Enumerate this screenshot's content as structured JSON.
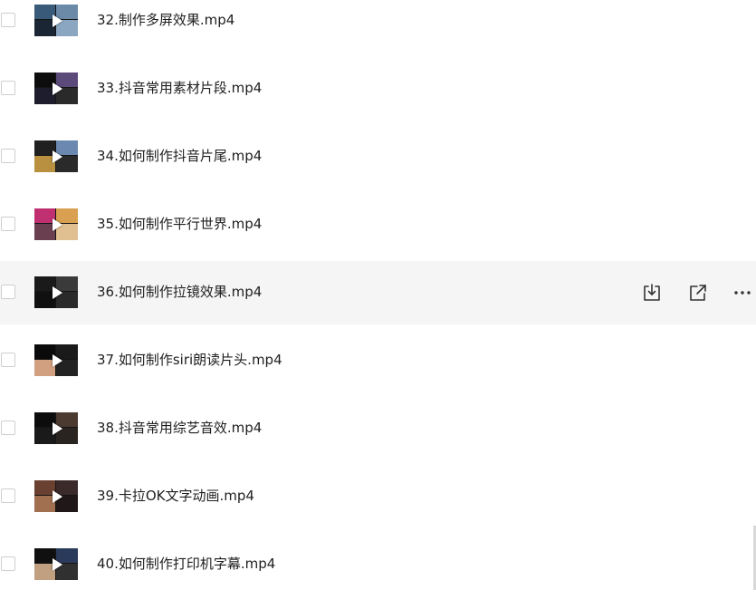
{
  "files": [
    {
      "name": "32.制作多屏效果.mp4",
      "thumb_colors": [
        "#3a5a7a",
        "#6a8aa8",
        "#1a2633",
        "#8aa6c0"
      ]
    },
    {
      "name": "33.抖音常用素材片段.mp4",
      "thumb_colors": [
        "#0d0d0d",
        "#5b4a7a",
        "#1d1d2d",
        "#2a2a2a"
      ]
    },
    {
      "name": "34.如何制作抖音片尾.mp4",
      "thumb_colors": [
        "#202020",
        "#6b88b0",
        "#b89040",
        "#2a2a2a"
      ]
    },
    {
      "name": "35.如何制作平行世界.mp4",
      "thumb_colors": [
        "#c03070",
        "#d8a050",
        "#6a4050",
        "#e0c090"
      ]
    },
    {
      "name": "36.如何制作拉镜效果.mp4",
      "thumb_colors": [
        "#1a1a1a",
        "#3a3a3a",
        "#101010",
        "#2a2a2a"
      ]
    },
    {
      "name": "37.如何制作siri朗读片头.mp4",
      "thumb_colors": [
        "#0a0a0a",
        "#1a1a1a",
        "#d0a080",
        "#222222"
      ]
    },
    {
      "name": "38.抖音常用综艺音效.mp4",
      "thumb_colors": [
        "#0c0c0c",
        "#4a3a30",
        "#1a1a1a",
        "#2a2420"
      ]
    },
    {
      "name": "39.卡拉OK文字动画.mp4",
      "thumb_colors": [
        "#6a4030",
        "#3a2a2a",
        "#a07050",
        "#201818"
      ]
    },
    {
      "name": "40.如何制作打印机字幕.mp4",
      "thumb_colors": [
        "#101010",
        "#2a3a5a",
        "#c0a080",
        "#303030"
      ]
    }
  ],
  "hovered_index": 4,
  "row_actions": {
    "icons": [
      "download-icon",
      "share-icon",
      "more-icon"
    ]
  },
  "colors": {
    "row_hover_bg": "#f5f5f5",
    "text": "#1f1f1f",
    "icon": "#333333"
  }
}
